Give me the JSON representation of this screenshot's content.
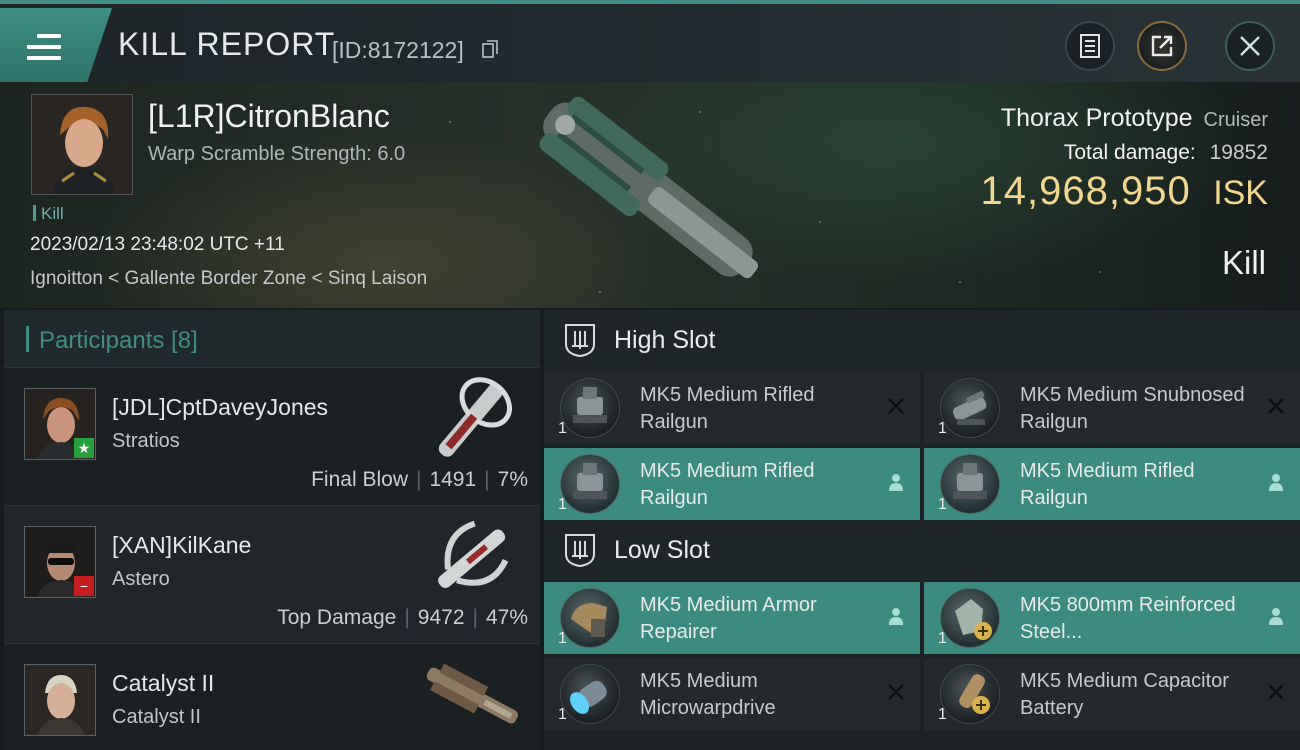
{
  "header": {
    "title": "KILL REPORT",
    "report_id": "[ID:8172122]"
  },
  "victim": {
    "name": "[L1R]CitronBlanc",
    "warp_scramble": "Warp Scramble Strength: 6.0",
    "tag": "Kill",
    "datetime": "2023/02/13 23:48:02 UTC +11",
    "location": "Ignoitton < Gallente Border Zone < Sinq Laison",
    "ship_name": "Thorax Prototype",
    "ship_class": "Cruiser",
    "total_damage_label": "Total damage:",
    "total_damage": "19852",
    "isk_value": "14,968,950",
    "isk_unit": "ISK",
    "result": "Kill"
  },
  "participants": {
    "header": "Participants [8]",
    "rows": [
      {
        "name": "[JDL]CptDaveyJones",
        "ship": "Stratios",
        "role": "Final Blow",
        "damage": "1491",
        "percent": "7%",
        "badge": "★",
        "badge_color": "#28a03c"
      },
      {
        "name": "[XAN]KilKane",
        "ship": "Astero",
        "role": "Top Damage",
        "damage": "9472",
        "percent": "47%",
        "badge": "−",
        "badge_color": "#c41d1d"
      },
      {
        "name": "Catalyst II",
        "ship": "Catalyst II",
        "role": "",
        "damage": "",
        "percent": ""
      }
    ]
  },
  "slots": {
    "high": {
      "label": "High Slot",
      "modules": [
        {
          "qty": "1",
          "name": "MK5 Medium Rifled Railgun",
          "state": "destroyed"
        },
        {
          "qty": "1",
          "name": "MK5 Medium Snubnosed Railgun",
          "state": "destroyed"
        },
        {
          "qty": "1",
          "name": "MK5 Medium Rifled Railgun",
          "state": "dropped"
        },
        {
          "qty": "1",
          "name": "MK5 Medium Rifled Railgun",
          "state": "dropped"
        }
      ]
    },
    "low": {
      "label": "Low Slot",
      "modules": [
        {
          "qty": "1",
          "name": "MK5 Medium Armor Repairer",
          "state": "dropped"
        },
        {
          "qty": "1",
          "name": "MK5 800mm Reinforced Steel...",
          "state": "dropped"
        },
        {
          "qty": "1",
          "name": "MK5 Medium Microwarpdrive",
          "state": "destroyed"
        },
        {
          "qty": "1",
          "name": "MK5 Medium Capacitor Battery",
          "state": "destroyed"
        }
      ]
    }
  },
  "colors": {
    "accent": "#3d8a80",
    "isk": "#f2d68c"
  }
}
